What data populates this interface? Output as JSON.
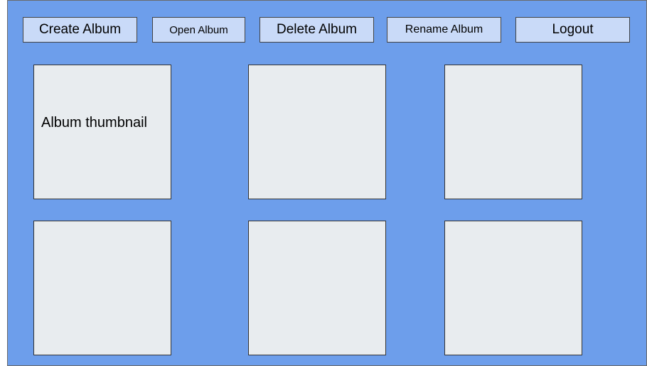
{
  "toolbar": {
    "create_label": "Create Album",
    "open_label": "Open Album",
    "delete_label": "Delete Album",
    "rename_label": "Rename Album",
    "logout_label": "Logout"
  },
  "albums": [
    {
      "caption": "Album thumbnail"
    },
    {
      "caption": ""
    },
    {
      "caption": ""
    },
    {
      "caption": ""
    },
    {
      "caption": ""
    },
    {
      "caption": ""
    }
  ],
  "colors": {
    "background": "#6d9eeb",
    "button_fill": "#c9daf8",
    "tile_fill": "#e8ecef"
  }
}
